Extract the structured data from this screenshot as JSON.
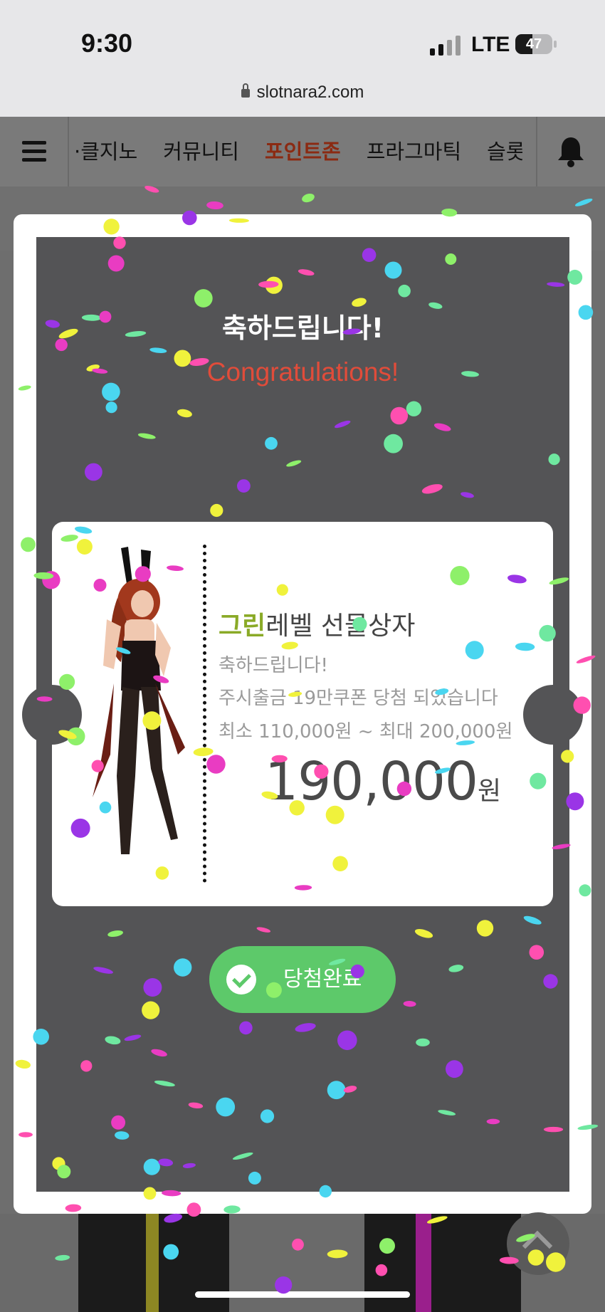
{
  "status_bar": {
    "time": "9:30",
    "network": "LTE",
    "battery_level": "47",
    "battery_fraction": 0.47,
    "url": "slotnara2.com"
  },
  "nav": {
    "items": [
      "·클지노",
      "커뮤니티",
      "포인트존",
      "프라그마틱",
      "슬롯"
    ],
    "active_index": 2
  },
  "modal": {
    "heading": "축하드립니다!",
    "subheading": "Congratulations!",
    "ticket": {
      "title_highlight": "그린",
      "title_rest": "레벨 선물상자",
      "line1": "축하드립니다!",
      "line2": "주시출금 19만쿠폰 당첨 되었습니다",
      "line3": "최소 110,000원 ~ 최대 200,000원",
      "amount": "190,000",
      "currency": "원"
    },
    "button_label": "당첨완료"
  },
  "colors": {
    "title_highlight": "#8aaa27",
    "subheading": "#e14c3a",
    "button": "#5dc96a",
    "overlay_inner": "#545456"
  },
  "icons": [
    "menu-icon",
    "bell-icon",
    "lock-icon",
    "check-icon",
    "chevron-up-icon"
  ]
}
